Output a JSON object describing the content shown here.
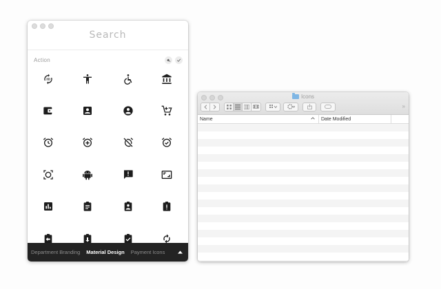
{
  "search": {
    "placeholder": "Search"
  },
  "section": {
    "title": "Action"
  },
  "icons": [
    "3d-rotation-icon",
    "accessibility-icon",
    "accessible-icon",
    "account-balance-icon",
    "account-balance-wallet-icon",
    "account-box-icon",
    "account-circle-icon",
    "add-shopping-cart-icon",
    "alarm-icon",
    "alarm-add-icon",
    "alarm-off-icon",
    "alarm-on-icon",
    "all-out-icon",
    "android-icon",
    "announcement-icon",
    "aspect-ratio-icon",
    "assessment-icon",
    "assignment-icon",
    "assignment-ind-icon",
    "assignment-late-icon",
    "assignment-return-icon",
    "assignment-returned-icon",
    "assignment-turned-in-icon",
    "autorenew-icon"
  ],
  "bottom_tabs": [
    {
      "label": "Department Branding",
      "active": false
    },
    {
      "label": "Material Design",
      "active": true
    },
    {
      "label": "Payment Icons",
      "active": false
    }
  ],
  "finder": {
    "title": "Icons",
    "columns": {
      "name": "Name",
      "date": "Date Modified"
    }
  }
}
